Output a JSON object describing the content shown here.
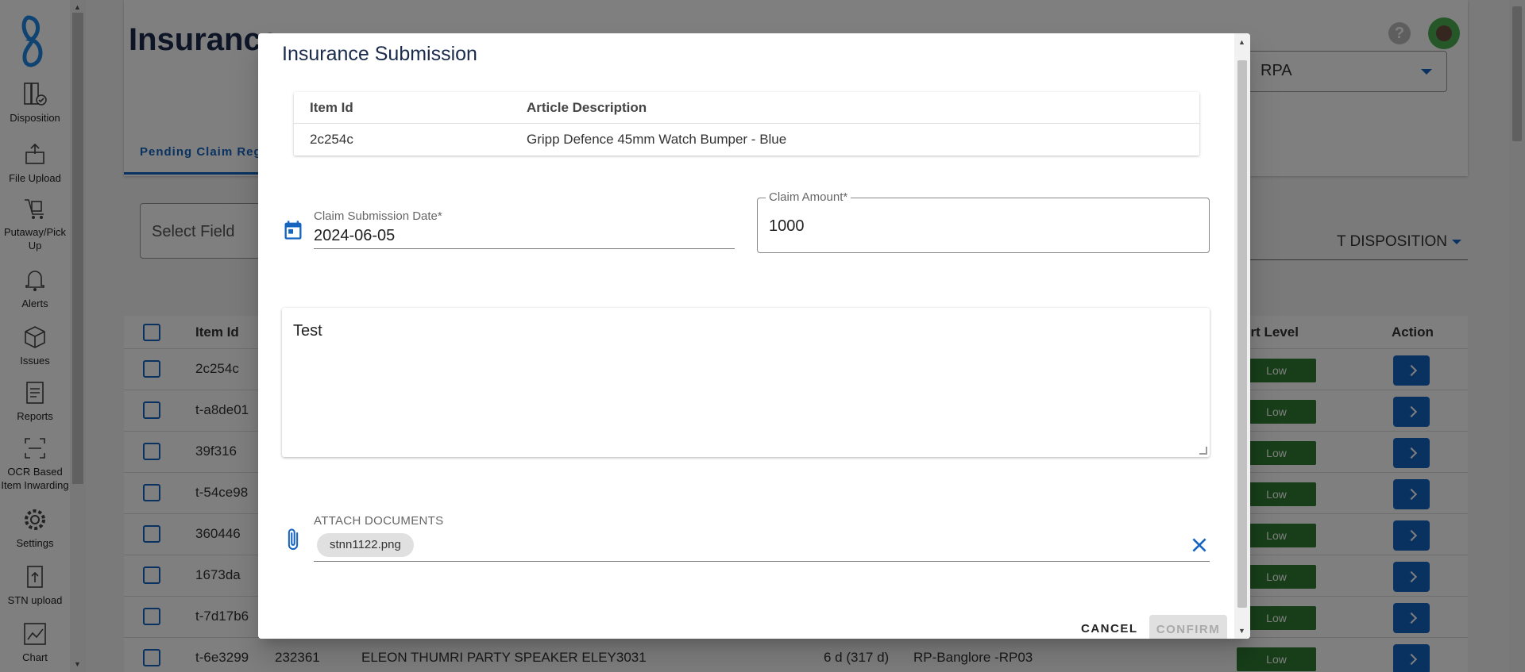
{
  "sidebar": {
    "items": [
      {
        "label": "Disposition",
        "icon": "disposition-icon"
      },
      {
        "label": "File Upload",
        "icon": "file-upload-icon"
      },
      {
        "label": "Putaway/Pick Up",
        "icon": "putaway-icon"
      },
      {
        "label": "Alerts",
        "icon": "bell-icon"
      },
      {
        "label": "Issues",
        "icon": "boxes-icon"
      },
      {
        "label": "Reports",
        "icon": "report-icon"
      },
      {
        "label": "OCR Based Item Inwarding",
        "icon": "scan-icon"
      },
      {
        "label": "Settings",
        "icon": "gear-icon"
      },
      {
        "label": "STN upload",
        "icon": "upload-doc-icon"
      },
      {
        "label": "Chart",
        "icon": "chart-icon"
      }
    ]
  },
  "page": {
    "title": "Insurance",
    "rpa_value": "RPA",
    "tab_label": "Pending Claim Reg",
    "select_field": "Select Field",
    "disposition_select": "T DISPOSITION",
    "table": {
      "headers": [
        "Item Id",
        "Alert Level",
        "Action"
      ],
      "rows": [
        {
          "id": "2c254c",
          "alert": "Low"
        },
        {
          "id": "t-a8de01",
          "alert": "Low"
        },
        {
          "id": "39f316",
          "alert": "Low"
        },
        {
          "id": "t-54ce98",
          "alert": "Low"
        },
        {
          "id": "360446",
          "alert": "Low"
        },
        {
          "id": "1673da",
          "alert": "Low"
        },
        {
          "id": "t-7d17b6",
          "alert": "Low"
        },
        {
          "id": "t-6e3299",
          "alert": "Low",
          "col2": "232361",
          "col3": "ELEON THUMRI PARTY SPEAKER ELEY3031",
          "col4": "6 d (317 d)",
          "col5": "RP-Banglore -RP03"
        }
      ]
    }
  },
  "dialog": {
    "title": "Insurance Submission",
    "item_table": {
      "headers": [
        "Item Id",
        "Article Description"
      ],
      "row": {
        "item_id": "2c254c",
        "description": "Gripp Defence 45mm Watch Bumper - Blue"
      }
    },
    "claim_date": {
      "label": "Claim Submission Date*",
      "value": "2024-06-05"
    },
    "claim_amount": {
      "label": "Claim Amount*",
      "value": "1000"
    },
    "notes": {
      "value": "Test"
    },
    "attach": {
      "label": "ATTACH DOCUMENTS",
      "file": "stnn1122.png"
    },
    "cancel_label": "CANCEL",
    "confirm_label": "CONFIRM"
  },
  "colors": {
    "primary": "#1565c0",
    "success": "#2e7d32",
    "title": "#1a2b4c"
  }
}
